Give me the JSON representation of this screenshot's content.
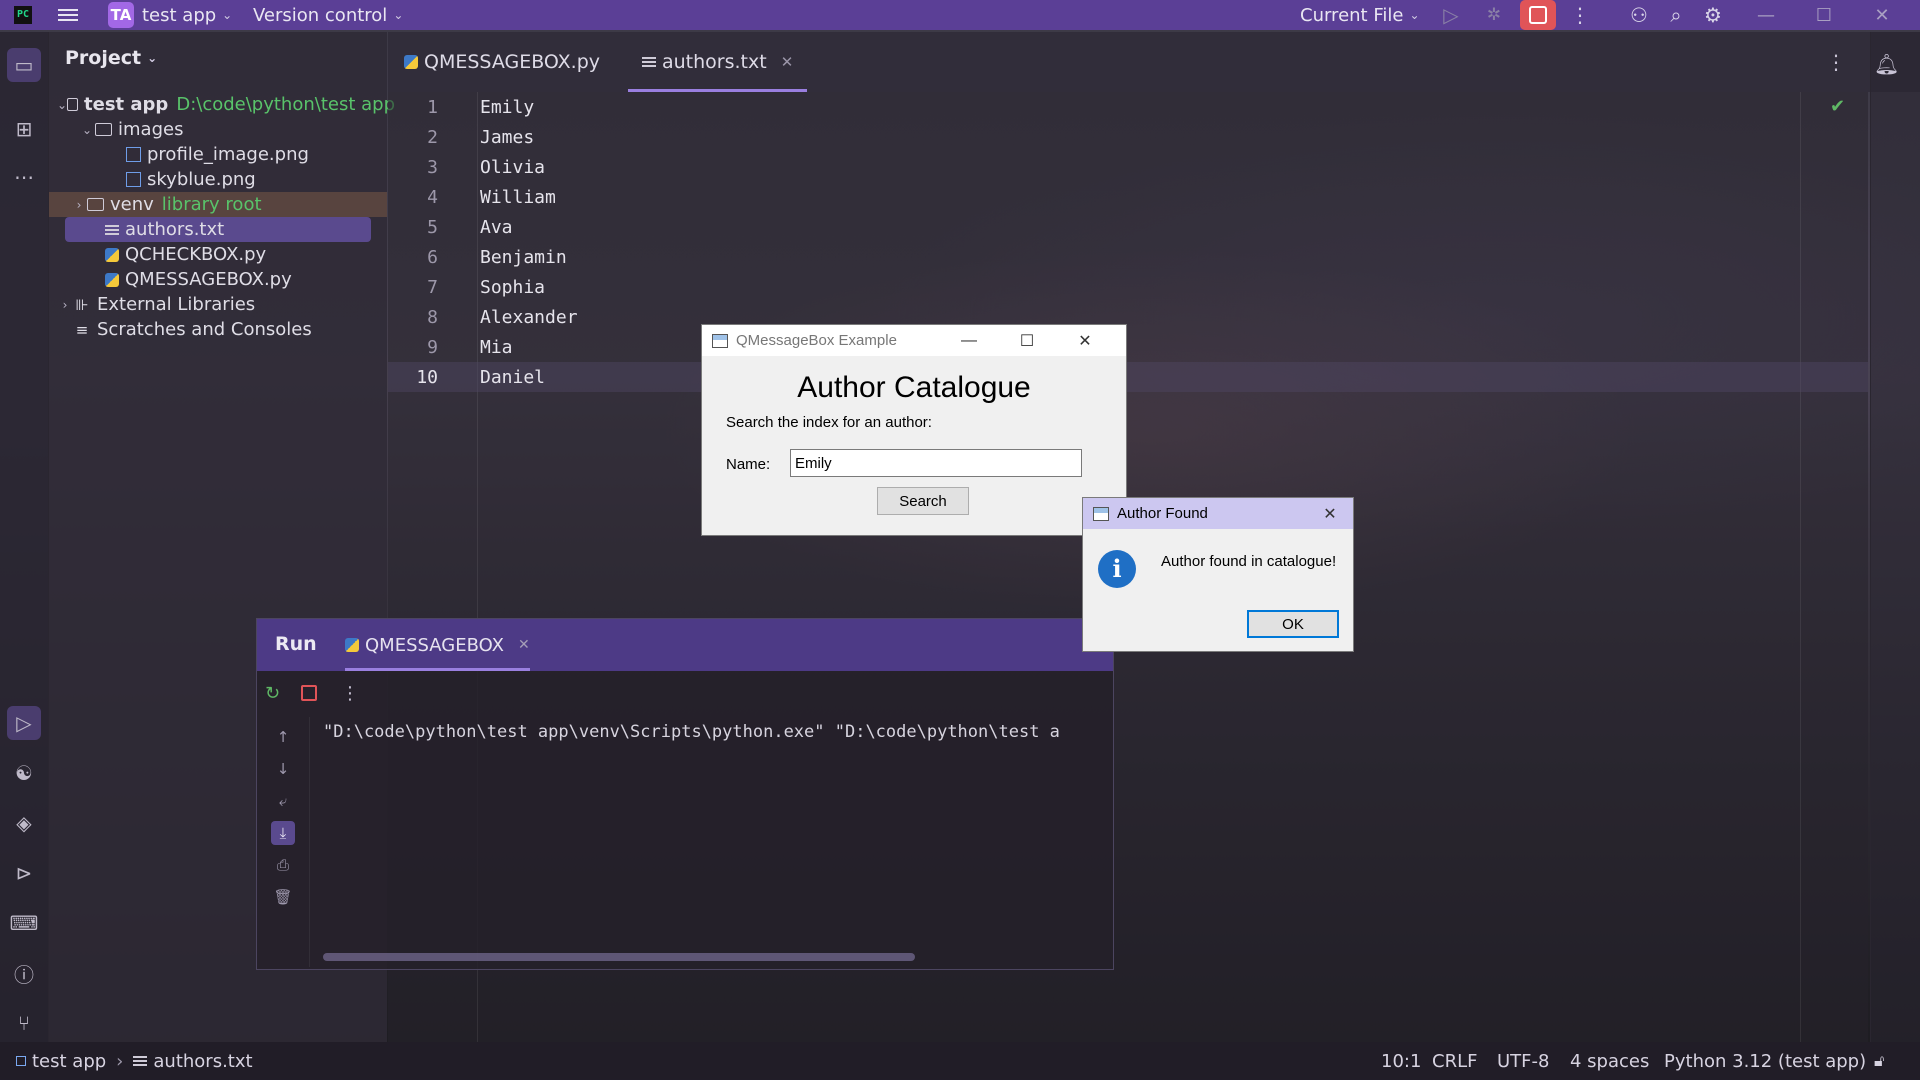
{
  "titlebar": {
    "project_badge": "TA",
    "project_name": "test app",
    "vcs_label": "Version control",
    "run_config": "Current File"
  },
  "project_panel": {
    "title": "Project",
    "root_name": "test app",
    "root_path": "D:\\code\\python\\test app",
    "images_folder": "images",
    "file_profile": "profile_image.png",
    "file_skyblue": "skyblue.png",
    "venv_folder": "venv",
    "venv_tag": "library root",
    "file_authors": "authors.txt",
    "file_qcheckbox": "QCHECKBOX.py",
    "file_qmessagebox": "QMESSAGEBOX.py",
    "external_libraries": "External Libraries",
    "scratches": "Scratches and Consoles"
  },
  "editor": {
    "tabs": [
      {
        "label": "QMESSAGEBOX.py"
      },
      {
        "label": "authors.txt"
      }
    ],
    "lines": [
      {
        "num": "1",
        "text": "Emily"
      },
      {
        "num": "2",
        "text": "James"
      },
      {
        "num": "3",
        "text": "Olivia"
      },
      {
        "num": "4",
        "text": "William"
      },
      {
        "num": "5",
        "text": "Ava"
      },
      {
        "num": "6",
        "text": "Benjamin"
      },
      {
        "num": "7",
        "text": "Sophia"
      },
      {
        "num": "8",
        "text": "Alexander"
      },
      {
        "num": "9",
        "text": "Mia"
      },
      {
        "num": "10",
        "text": "Daniel"
      }
    ]
  },
  "run_panel": {
    "title": "Run",
    "tab_label": "QMESSAGEBOX",
    "output": "\"D:\\code\\python\\test app\\venv\\Scripts\\python.exe\" \"D:\\code\\python\\test a"
  },
  "main_window": {
    "title": "QMessageBox Example",
    "heading": "Author Catalogue",
    "prompt": "Search the index for an author:",
    "name_label": "Name:",
    "name_value": "Emily",
    "search_button": "Search"
  },
  "message_box": {
    "title": "Author Found",
    "message": "Author found in catalogue!",
    "ok_button": "OK"
  },
  "statusbar": {
    "crumb_project": "test app",
    "crumb_file": "authors.txt",
    "position": "10:1",
    "line_ending": "CRLF",
    "encoding": "UTF-8",
    "indent": "4 spaces",
    "interpreter": "Python 3.12 (test app)"
  }
}
